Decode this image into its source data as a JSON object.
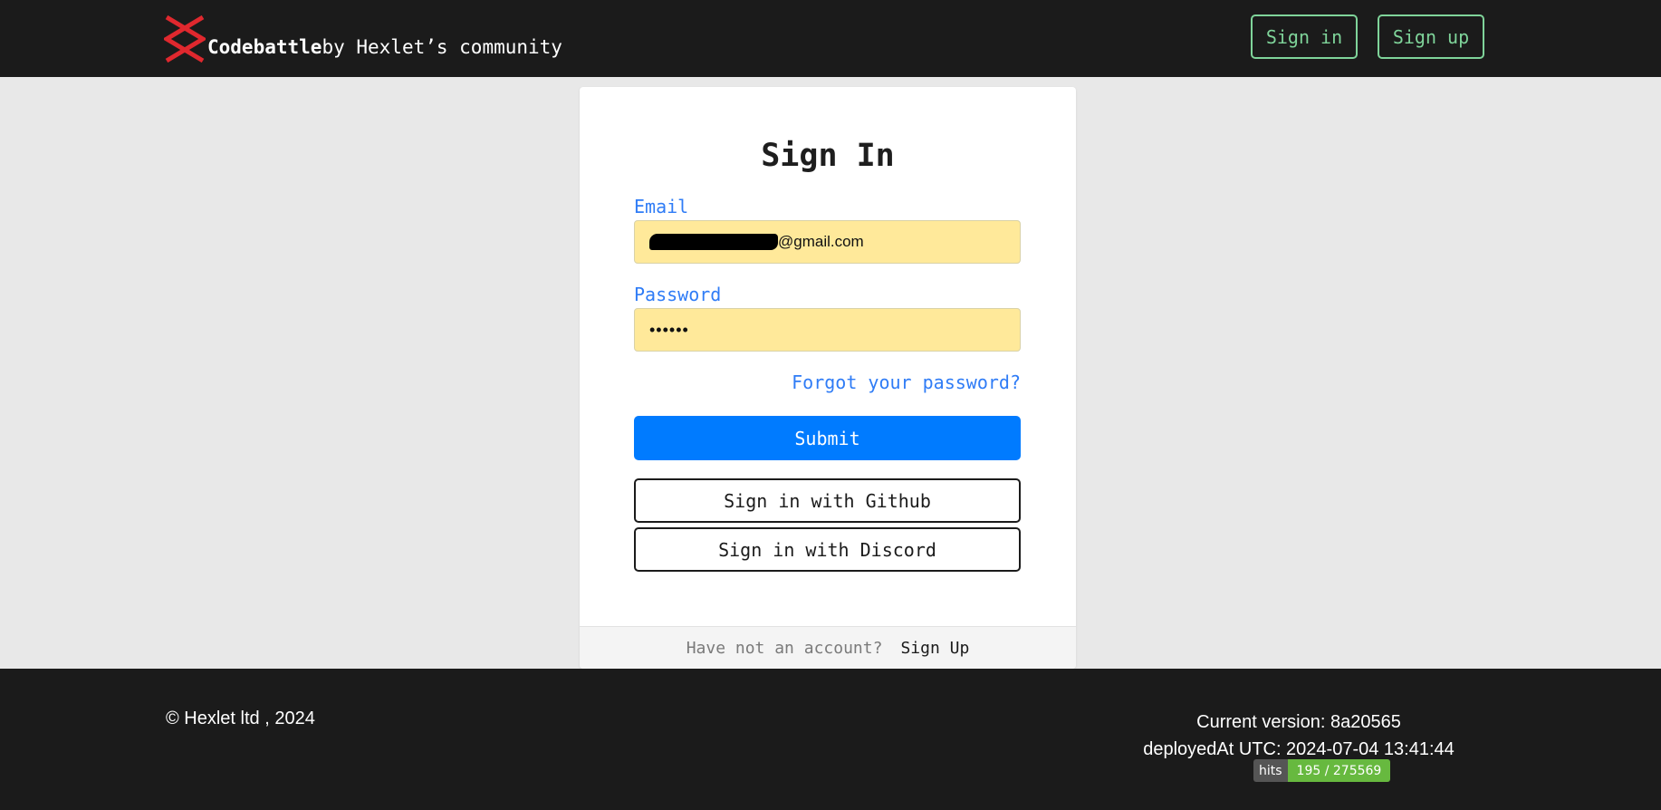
{
  "navbar": {
    "brand_name": "Codebattle",
    "brand_tagline": "by Hexlet’s community",
    "sign_in_label": "Sign in",
    "sign_up_label": "Sign up",
    "logo_color": "#e0282e"
  },
  "form": {
    "title": "Sign In",
    "email_label": "Email",
    "email_value_visible": "@gmail.com",
    "password_label": "Password",
    "password_value": "••••••",
    "forgot_label": "Forgot your password?",
    "submit_label": "Submit",
    "github_label": "Sign in with Github",
    "discord_label": "Sign in with Discord",
    "footer_question": "Have not an account?",
    "footer_signup": "Sign Up"
  },
  "footer": {
    "copyright": "© Hexlet ltd , 2024",
    "current_version": "Current version: 8a20565",
    "deployed_at": "deployedAt UTC: 2024-07-04 13:41:44",
    "hits_label": "hits",
    "hits_value": "195 / 275569"
  },
  "colors": {
    "nav_bg": "#1b1b1b",
    "accent_green": "#7fd49a",
    "link_blue": "#2f7cf6",
    "primary_button": "#007bff",
    "input_autofill": "#ffe99a",
    "hits_green": "#67b93f"
  }
}
